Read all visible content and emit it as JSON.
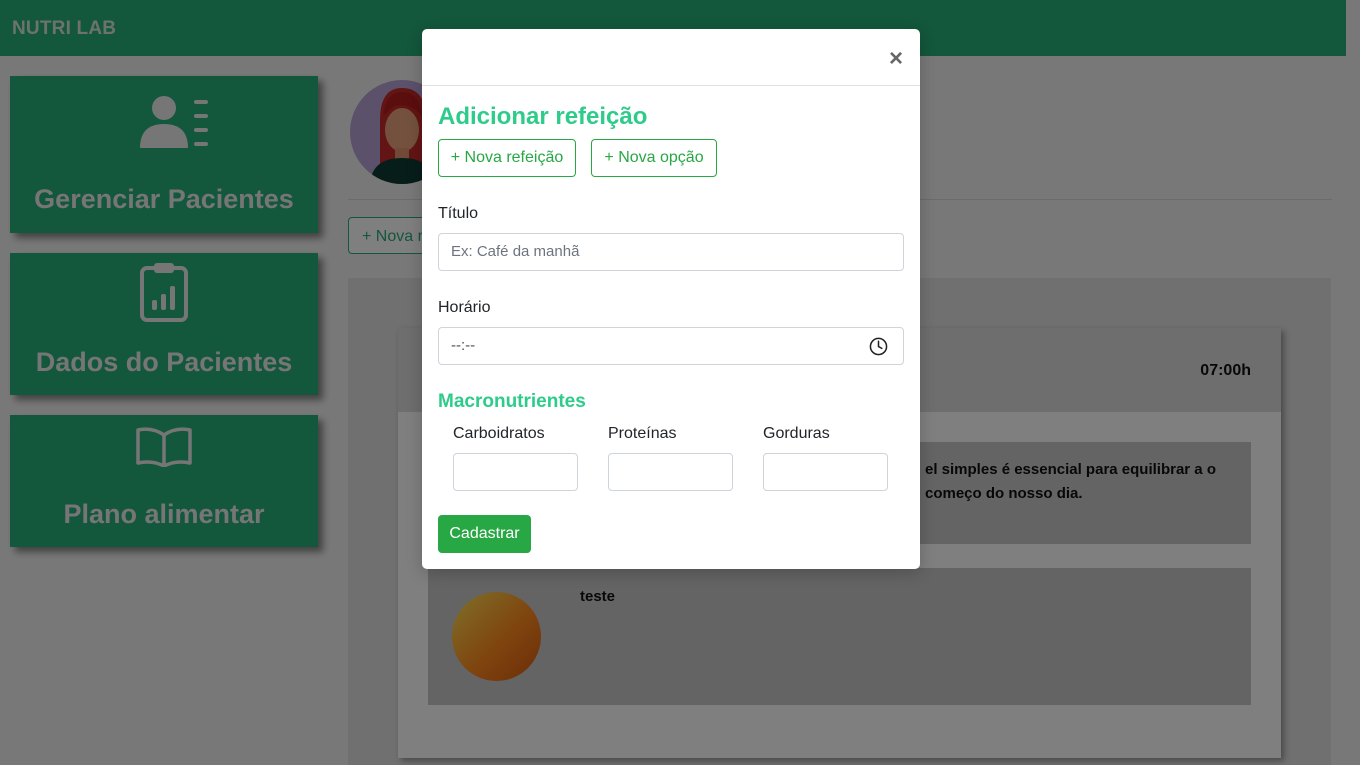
{
  "app": {
    "brand": "NUTRI LAB"
  },
  "sidebar": {
    "items": [
      {
        "label": "Gerenciar Pacientes",
        "icon": "user-list-icon"
      },
      {
        "label": "Dados do Pacientes",
        "icon": "clipboard-chart-icon"
      },
      {
        "label": "Plano alimentar",
        "icon": "open-book-icon"
      }
    ]
  },
  "background": {
    "new_meal_button": "+ Nova refeição",
    "meal_time": "07:00h",
    "option_text": "el simples é essencial para equilibrar a o começo do nosso dia.",
    "option2_title": "teste"
  },
  "modal": {
    "title": "Adicionar refeição",
    "new_meal_button": "+ Nova refeição",
    "new_option_button": "+ Nova opção",
    "title_label": "Título",
    "title_placeholder": "Ex: Café da manhã",
    "time_label": "Horário",
    "time_value": "--:--",
    "macros_title": "Macronutrientes",
    "macros": {
      "carbs_label": "Carboidratos",
      "protein_label": "Proteínas",
      "fat_label": "Gorduras"
    },
    "submit_label": "Cadastrar",
    "close_symbol": "×"
  },
  "colors": {
    "brand_green": "#27ae78",
    "accent_green": "#2ecc8a",
    "button_green": "#28a745"
  }
}
